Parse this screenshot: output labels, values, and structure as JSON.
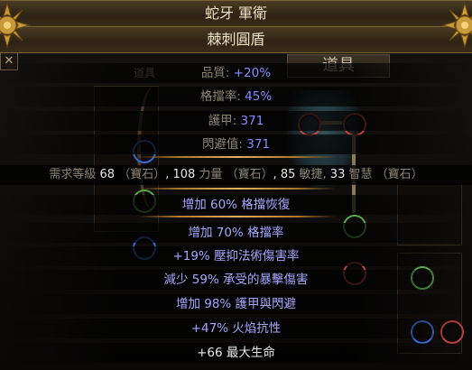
{
  "item": {
    "name": "蛇牙 軍衛",
    "base_type": "棘刺圓盾",
    "properties": [
      {
        "label": "品質: ",
        "value": "+20%"
      },
      {
        "label": "格擋率: ",
        "value": "45%"
      },
      {
        "label": "護甲: ",
        "value": "371"
      },
      {
        "label": "閃避值: ",
        "value": "371"
      }
    ],
    "requirements": {
      "prefix": "需求等級 ",
      "level": "68",
      "gem1": " （寶石）",
      "sep1": ", ",
      "str_val": "108",
      "str_lbl": " 力量 ",
      "gem2": "（寶石）",
      "sep2": ", ",
      "dex_val": "85",
      "dex_lbl": " 敏捷, ",
      "int_val": "33",
      "int_lbl": " 智慧 ",
      "gem3": "（寶石）"
    },
    "implicit": "增加 60% 格擋恢復",
    "mods": [
      "增加 70% 格擋率",
      "+19% 壓抑法術傷害率",
      "減少 59% 承受的暴擊傷害",
      "增加 98% 護甲與閃避",
      "+47% 火焰抗性",
      "+66 最大生命"
    ]
  },
  "background": {
    "tab_label": "道具",
    "inventory_title": "道具",
    "close_glyph": "✕"
  },
  "colors": {
    "header_text": "#eee3c4",
    "magic_blue": "#8888ff",
    "separator_gold": "#c8983f"
  }
}
